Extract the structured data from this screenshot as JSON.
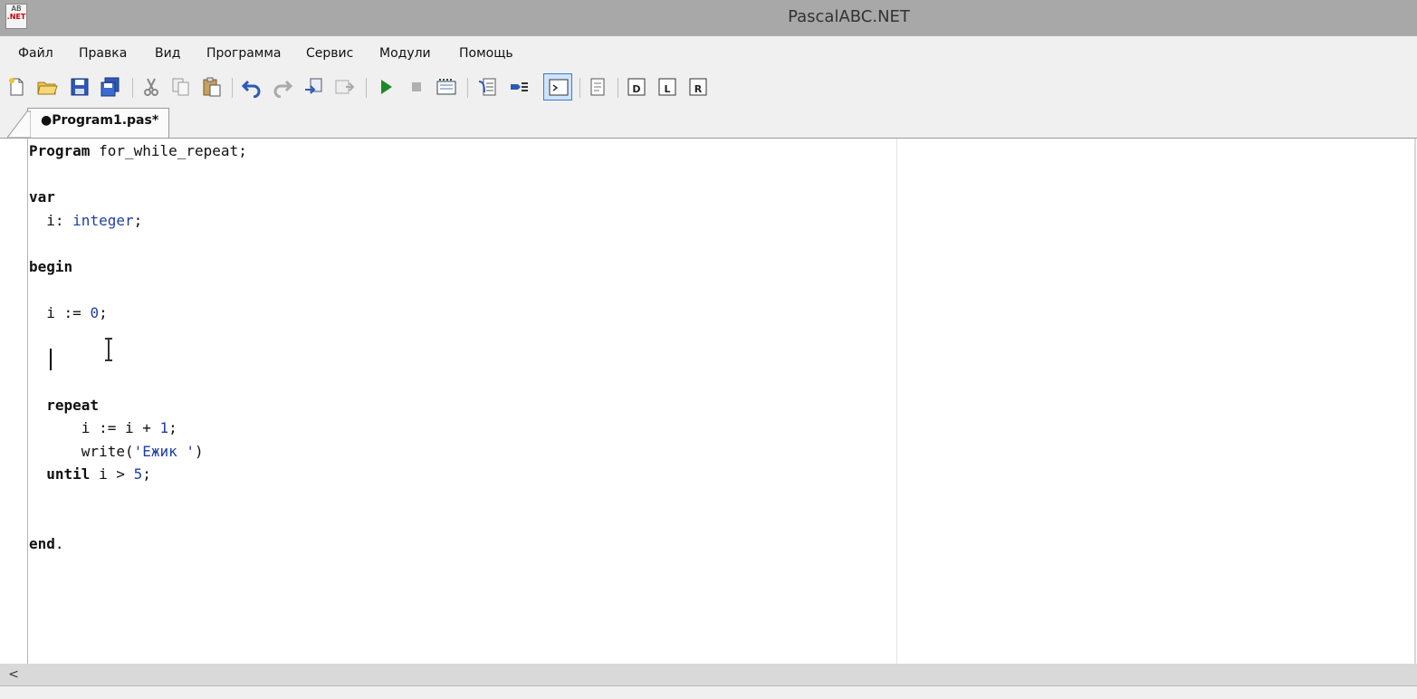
{
  "window": {
    "title": "PascalABC.NET",
    "icon_text_top": "AB",
    "icon_text_bottom": ".NET"
  },
  "menu": {
    "items": [
      "Файл",
      "Правка",
      "Вид",
      "Программа",
      "Сервис",
      "Модули",
      "Помощь"
    ]
  },
  "toolbar": {
    "buttons": [
      {
        "name": "new-file-icon"
      },
      {
        "name": "open-folder-icon"
      },
      {
        "name": "save-icon"
      },
      {
        "name": "save-all-icon"
      },
      {
        "name": "cut-icon"
      },
      {
        "name": "copy-icon"
      },
      {
        "name": "paste-icon"
      },
      {
        "name": "undo-icon"
      },
      {
        "name": "redo-icon"
      },
      {
        "name": "compile-icon"
      },
      {
        "name": "build-icon"
      },
      {
        "name": "run-icon",
        "color": "#1c8a2a"
      },
      {
        "name": "stop-icon"
      },
      {
        "name": "debug-window-icon"
      },
      {
        "name": "step-into-icon"
      },
      {
        "name": "step-over-icon"
      },
      {
        "name": "output-window-icon",
        "active": true
      },
      {
        "name": "document-icon"
      },
      {
        "name": "form-designer-d-icon"
      },
      {
        "name": "form-designer-l-icon"
      },
      {
        "name": "form-designer-r-icon"
      }
    ]
  },
  "tabs": [
    {
      "label": "●Program1.pas*"
    }
  ],
  "editor": {
    "lines": [
      "Program for_while_repeat;",
      "",
      "var",
      "  i: integer;",
      "",
      "begin",
      "",
      "  i := 0;",
      "",
      "",
      "",
      "  repeat",
      "      i := i + 1;",
      "      write('Ежик ')",
      "  until i > 5;",
      "",
      "",
      "end."
    ],
    "colors": {
      "keyword": "#111111",
      "type": "#1e3ea6",
      "number": "#1e3ea6",
      "string": "#1e3ea6"
    }
  },
  "scrollbar": {
    "left_arrow": "<"
  }
}
